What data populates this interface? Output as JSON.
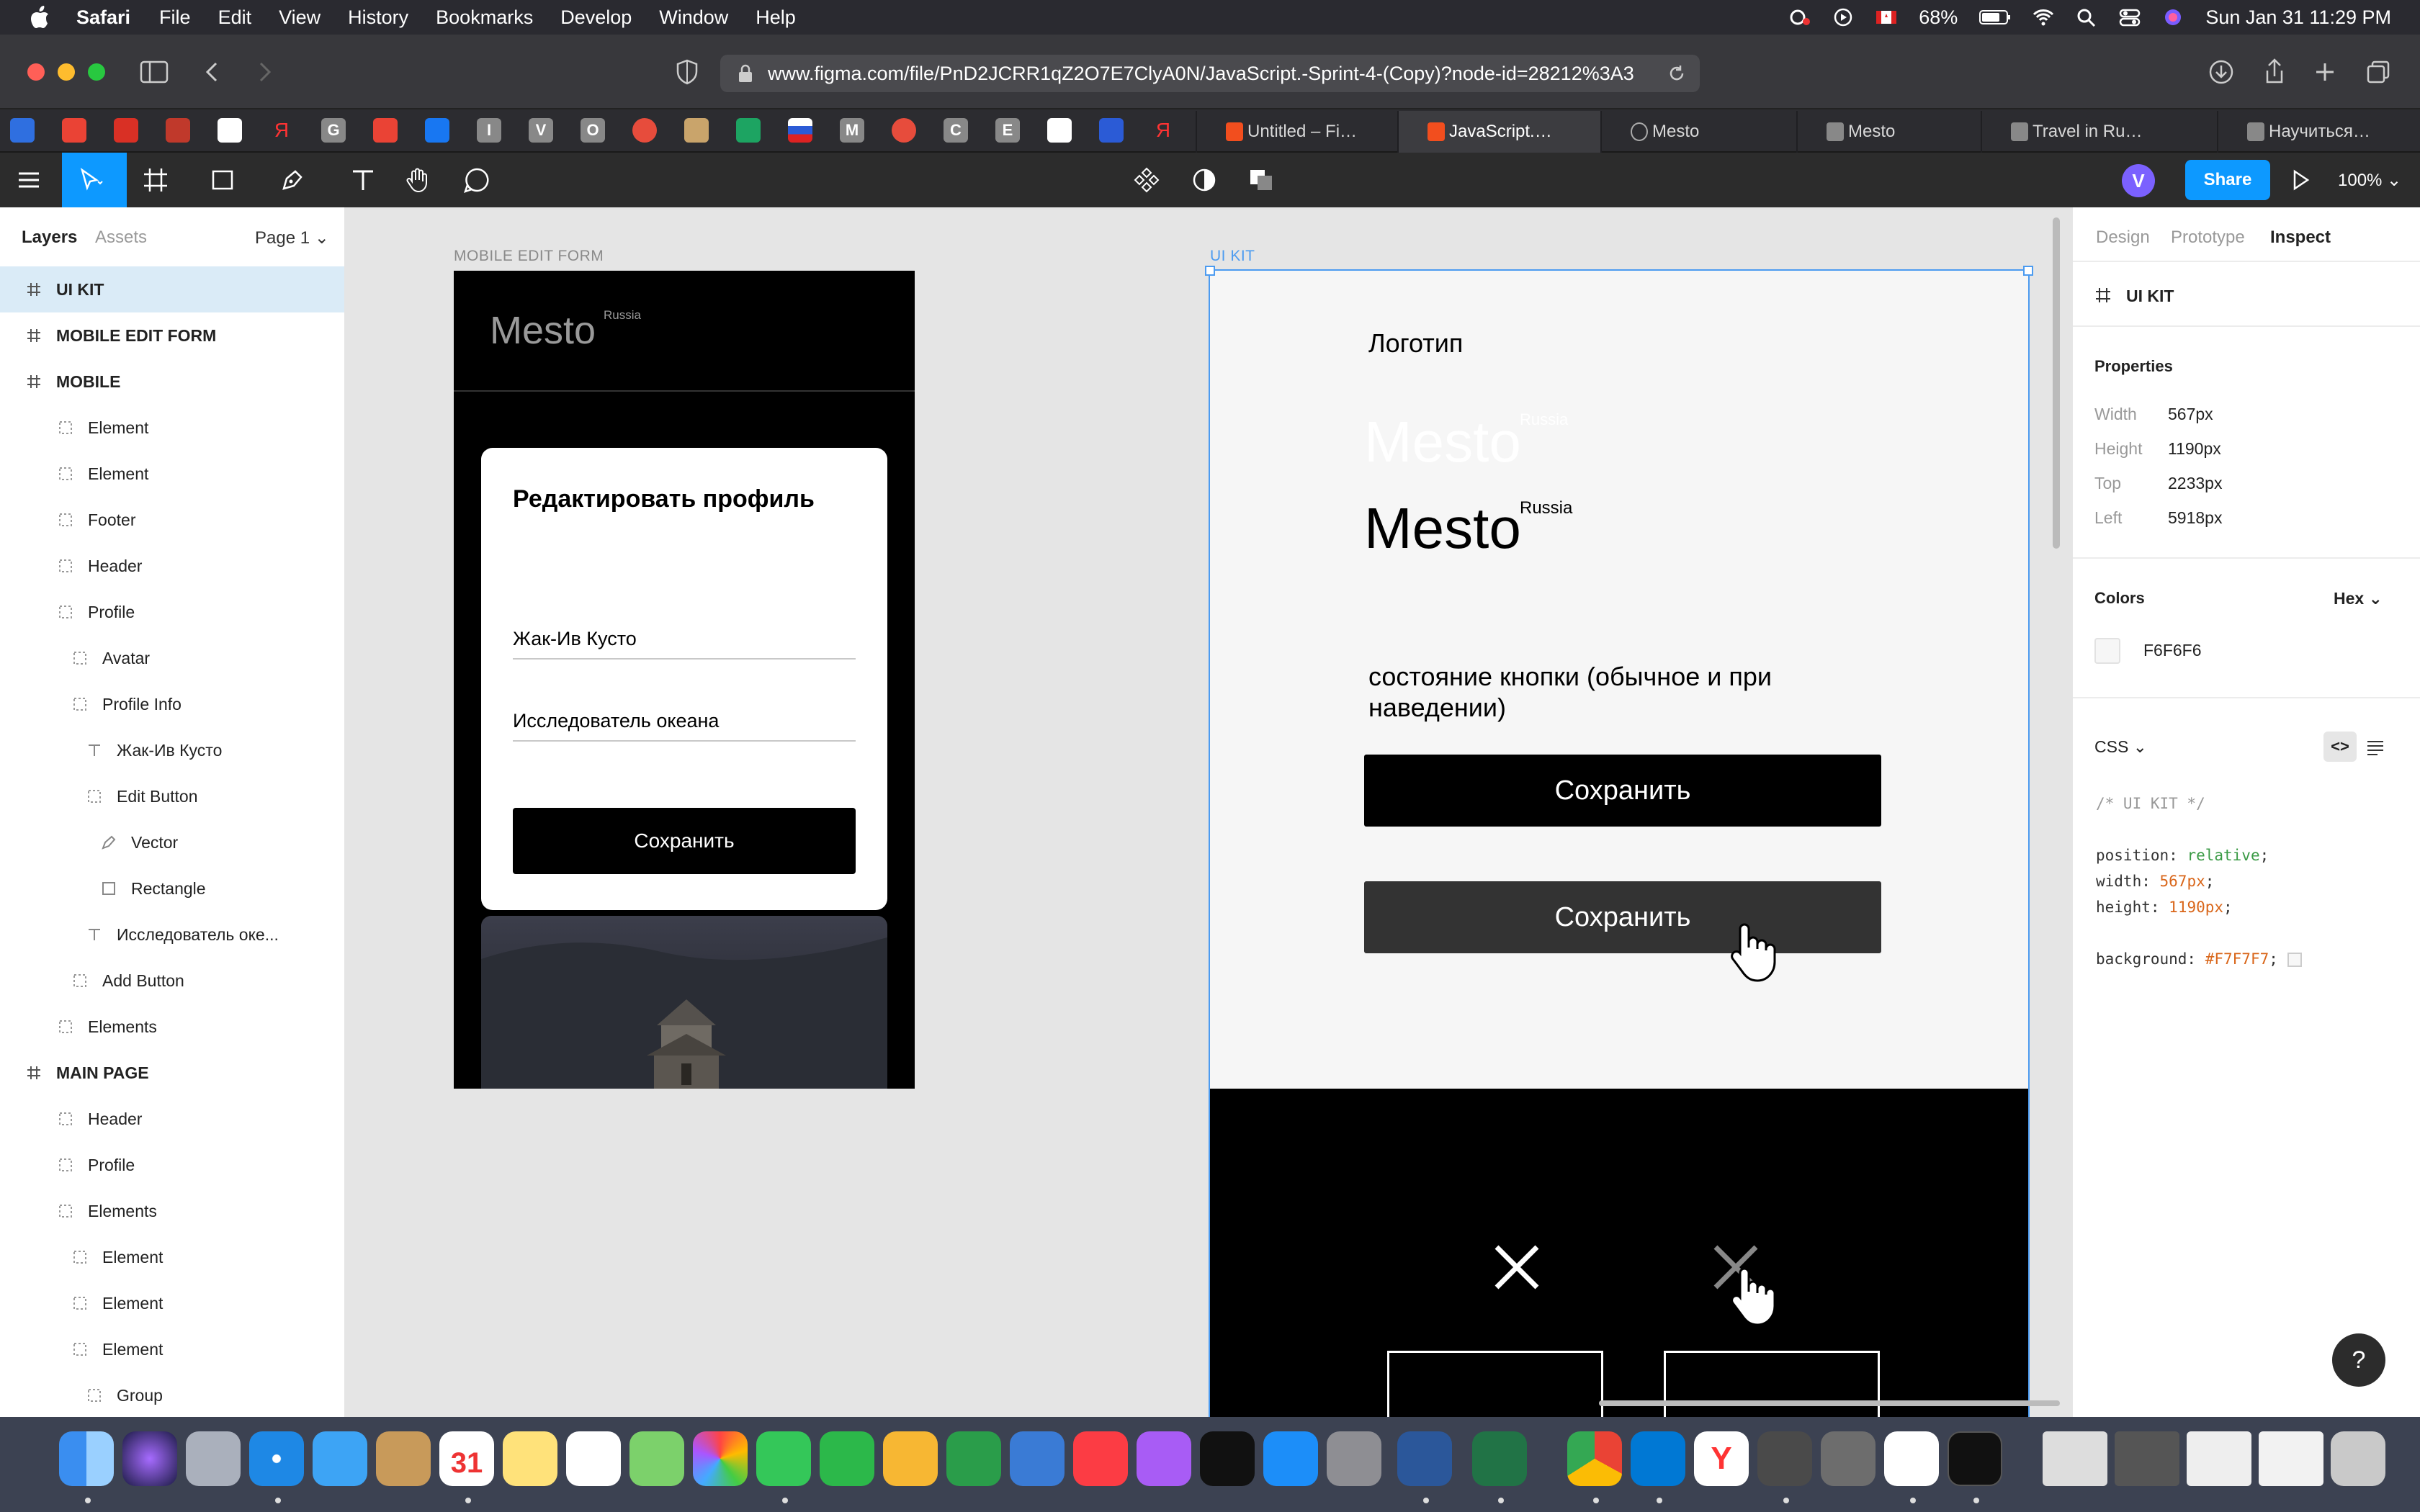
{
  "menubar": {
    "app": "Safari",
    "menus": [
      "File",
      "Edit",
      "View",
      "History",
      "Bookmarks",
      "Develop",
      "Window",
      "Help"
    ],
    "battery": "68%",
    "clock": "Sun Jan 31  11:29 PM"
  },
  "browser": {
    "url": "www.figma.com/file/PnD2JCRR1qZ2O7E7ClyA0N/JavaScript.-Sprint-4-(Copy)?node-id=28212%3A3",
    "tabs": [
      {
        "label": "Untitled – Fi…",
        "active": false
      },
      {
        "label": "JavaScript.…",
        "active": true
      },
      {
        "label": "Mesto",
        "active": false
      },
      {
        "label": "Mesto",
        "active": false
      },
      {
        "label": "Travel in Ru…",
        "active": false
      },
      {
        "label": "Научиться…",
        "active": false
      }
    ],
    "bookmark_letters": [
      "Я",
      "G",
      "I",
      "V",
      "O",
      "M",
      "C",
      "E",
      "Я"
    ]
  },
  "toolbar": {
    "avatar_initial": "V",
    "share_label": "Share",
    "zoom": "100%"
  },
  "left_panel": {
    "tabs": {
      "layers": "Layers",
      "assets": "Assets",
      "page": "Page 1"
    },
    "layers": [
      {
        "label": "UI KIT",
        "indent": 0,
        "type": "frame",
        "selected": true
      },
      {
        "label": "MOBILE EDIT FORM",
        "indent": 0,
        "type": "frame"
      },
      {
        "label": "MOBILE",
        "indent": 0,
        "type": "frame"
      },
      {
        "label": "Element",
        "indent": 1,
        "type": "group"
      },
      {
        "label": "Element",
        "indent": 1,
        "type": "group"
      },
      {
        "label": "Footer",
        "indent": 1,
        "type": "group"
      },
      {
        "label": "Header",
        "indent": 1,
        "type": "group"
      },
      {
        "label": "Profile",
        "indent": 1,
        "type": "group"
      },
      {
        "label": "Avatar",
        "indent": 2,
        "type": "group"
      },
      {
        "label": "Profile Info",
        "indent": 2,
        "type": "group"
      },
      {
        "label": "Жак-Ив Кусто",
        "indent": 3,
        "type": "text"
      },
      {
        "label": "Edit Button",
        "indent": 3,
        "type": "group"
      },
      {
        "label": "Vector",
        "indent": 4,
        "type": "vector"
      },
      {
        "label": "Rectangle",
        "indent": 4,
        "type": "rect"
      },
      {
        "label": "Исследователь оке...",
        "indent": 3,
        "type": "text"
      },
      {
        "label": "Add Button",
        "indent": 2,
        "type": "group"
      },
      {
        "label": "Elements",
        "indent": 1,
        "type": "group"
      },
      {
        "label": "MAIN PAGE",
        "indent": 0,
        "type": "frame"
      },
      {
        "label": "Header",
        "indent": 1,
        "type": "group"
      },
      {
        "label": "Profile",
        "indent": 1,
        "type": "group"
      },
      {
        "label": "Elements",
        "indent": 1,
        "type": "group"
      },
      {
        "label": "Element",
        "indent": 2,
        "type": "group"
      },
      {
        "label": "Element",
        "indent": 2,
        "type": "group"
      },
      {
        "label": "Element",
        "indent": 2,
        "type": "group"
      },
      {
        "label": "Group",
        "indent": 3,
        "type": "group"
      }
    ]
  },
  "canvas": {
    "mobile_frame": {
      "label": "MOBILE EDIT FORM",
      "logo": "Mesto",
      "logo_sub": "Russia",
      "popup_title": "Редактировать профиль",
      "field_name": "Жак-Ив Кусто",
      "field_about": "Исследователь океана",
      "save_label": "Сохранить"
    },
    "uikit_frame": {
      "label": "UI KIT",
      "logo_heading": "Логотип",
      "logo": "Mesto",
      "logo_sub": "Russia",
      "button_state_heading": "состояние кнопки (обычное и при наведении)",
      "button_normal": "Сохранить",
      "button_hover": "Сохранить"
    },
    "help": "?"
  },
  "right_panel": {
    "tabs": [
      "Design",
      "Prototype",
      "Inspect"
    ],
    "active_tab": "Inspect",
    "node_name": "UI KIT",
    "properties_heading": "Properties",
    "properties": [
      {
        "label": "Width",
        "value": "567px"
      },
      {
        "label": "Height",
        "value": "1190px"
      },
      {
        "label": "Top",
        "value": "2233px"
      },
      {
        "label": "Left",
        "value": "5918px"
      }
    ],
    "colors_heading": "Colors",
    "color_format": "Hex",
    "color_value": "F6F6F6",
    "css_heading": "CSS",
    "css": {
      "comment": "/* UI KIT */",
      "position_key": "position:",
      "position_val": "relative",
      "width_key": "width:",
      "width_val": "567px",
      "height_key": "height:",
      "height_val": "1190px",
      "bg_key": "background:",
      "bg_val": "#F7F7F7"
    }
  },
  "colors": {
    "figma_blue": "#0d99ff",
    "selection": "#4c9bf0",
    "canvas_bg": "#e5e5e5"
  }
}
